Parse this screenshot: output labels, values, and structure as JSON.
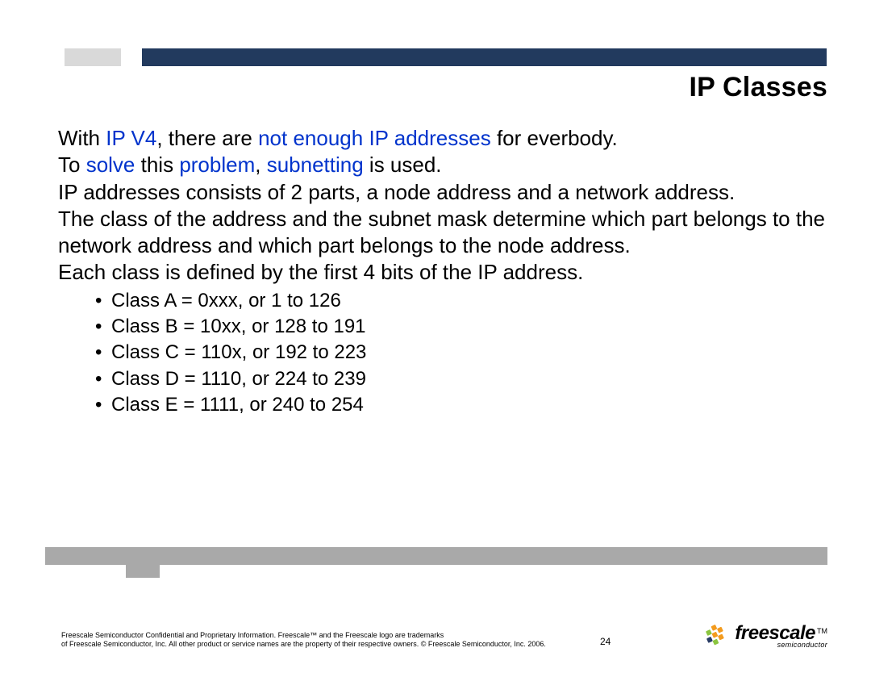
{
  "title": "IP Classes",
  "body": {
    "line1_pre": "With ",
    "line1_blue1": "IP V4",
    "line1_mid1": ", there are ",
    "line1_blue2": "not enough IP addresses",
    "line1_post": " for everbody.",
    "line2_pre": "To ",
    "line2_blue1": "solve",
    "line2_mid1": " this ",
    "line2_blue2": "problem",
    "line2_mid2": ", ",
    "line2_blue3": "subnetting",
    "line2_post": " is used.",
    "line3": "IP addresses consists of 2 parts, a node address and a network address.",
    "line4": "The class of the address and the subnet mask determine which part belongs to the network address and which part belongs to the node address.",
    "line5": "Each class is defined by the first 4 bits of the IP address."
  },
  "bullets": [
    "Class A = 0xxx, or 1 to 126",
    "Class B = 10xx, or 128 to 191",
    "Class C = 110x, or 192 to 223",
    "Class D = 1110, or 224 to 239",
    "Class E = 1111, or 240 to 254"
  ],
  "footnote_line1": "Freescale Semiconductor Confidential and Proprietary Information. Freescale™ and the Freescale logo are trademarks",
  "footnote_line2": "of Freescale Semiconductor, Inc. All other product or service names are the property of their respective owners. © Freescale Semiconductor, Inc. 2006.",
  "page_number": "24",
  "logo": {
    "word": "freescale",
    "tm": "TM",
    "sub": "semiconductor"
  },
  "colors": {
    "navy": "#223a5e",
    "grey_light": "#d9d9d9",
    "grey_mid": "#a9a9a9",
    "link_blue": "#0033cc",
    "logo_orange": "#f39b1e",
    "logo_green": "#8bc53f",
    "logo_darknavy": "#2a3d66"
  }
}
